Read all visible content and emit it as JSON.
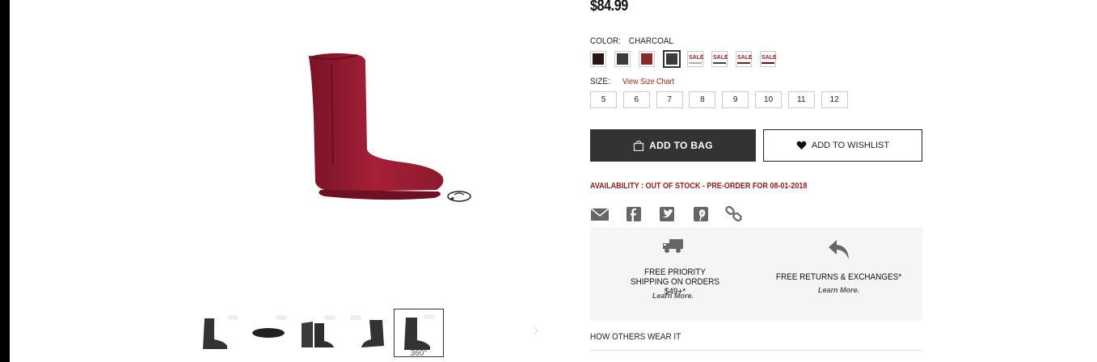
{
  "product": {
    "price": "$84.99",
    "color_label": "COLOR:",
    "color_value": "CHARCOAL",
    "size_label": "SIZE:",
    "size_chart_link": "View Size Chart",
    "swatches": [
      {
        "color": "#2a1414",
        "sale": false
      },
      {
        "color": "#3a3a3c",
        "sale": false
      },
      {
        "color": "#8a2a2a",
        "sale": false
      },
      {
        "color": "#3b3b3b",
        "sale": false,
        "selected": true
      },
      {
        "color": "#b0b0b0",
        "sale": true
      },
      {
        "color": "#444444",
        "sale": true
      },
      {
        "color": "#7b1f1f",
        "sale": true
      },
      {
        "color": "#5a1414",
        "sale": true
      }
    ],
    "sale_text": "SALE",
    "sizes": [
      "5",
      "6",
      "7",
      "8",
      "9",
      "10",
      "11",
      "12"
    ],
    "add_to_bag": "ADD TO BAG",
    "add_to_wishlist": "ADD TO WISHLIST",
    "availability": "AVAILABILITY : OUT OF STOCK - PRE-ORDER FOR 08-01-2018"
  },
  "share": {
    "icons": [
      "email-icon",
      "facebook-icon",
      "twitter-icon",
      "pinterest-icon",
      "link-icon"
    ]
  },
  "promos": {
    "shipping_title": "FREE PRIORITY SHIPPING ON ORDERS $49+*",
    "shipping_link": "Learn More.",
    "returns_title": "FREE RETURNS & EXCHANGES*",
    "returns_link": "Learn More."
  },
  "gallery": {
    "thumb_active_label": "360°",
    "boot_color": "#8b1a2b"
  },
  "others": {
    "title": "HOW OTHERS WEAR IT"
  }
}
